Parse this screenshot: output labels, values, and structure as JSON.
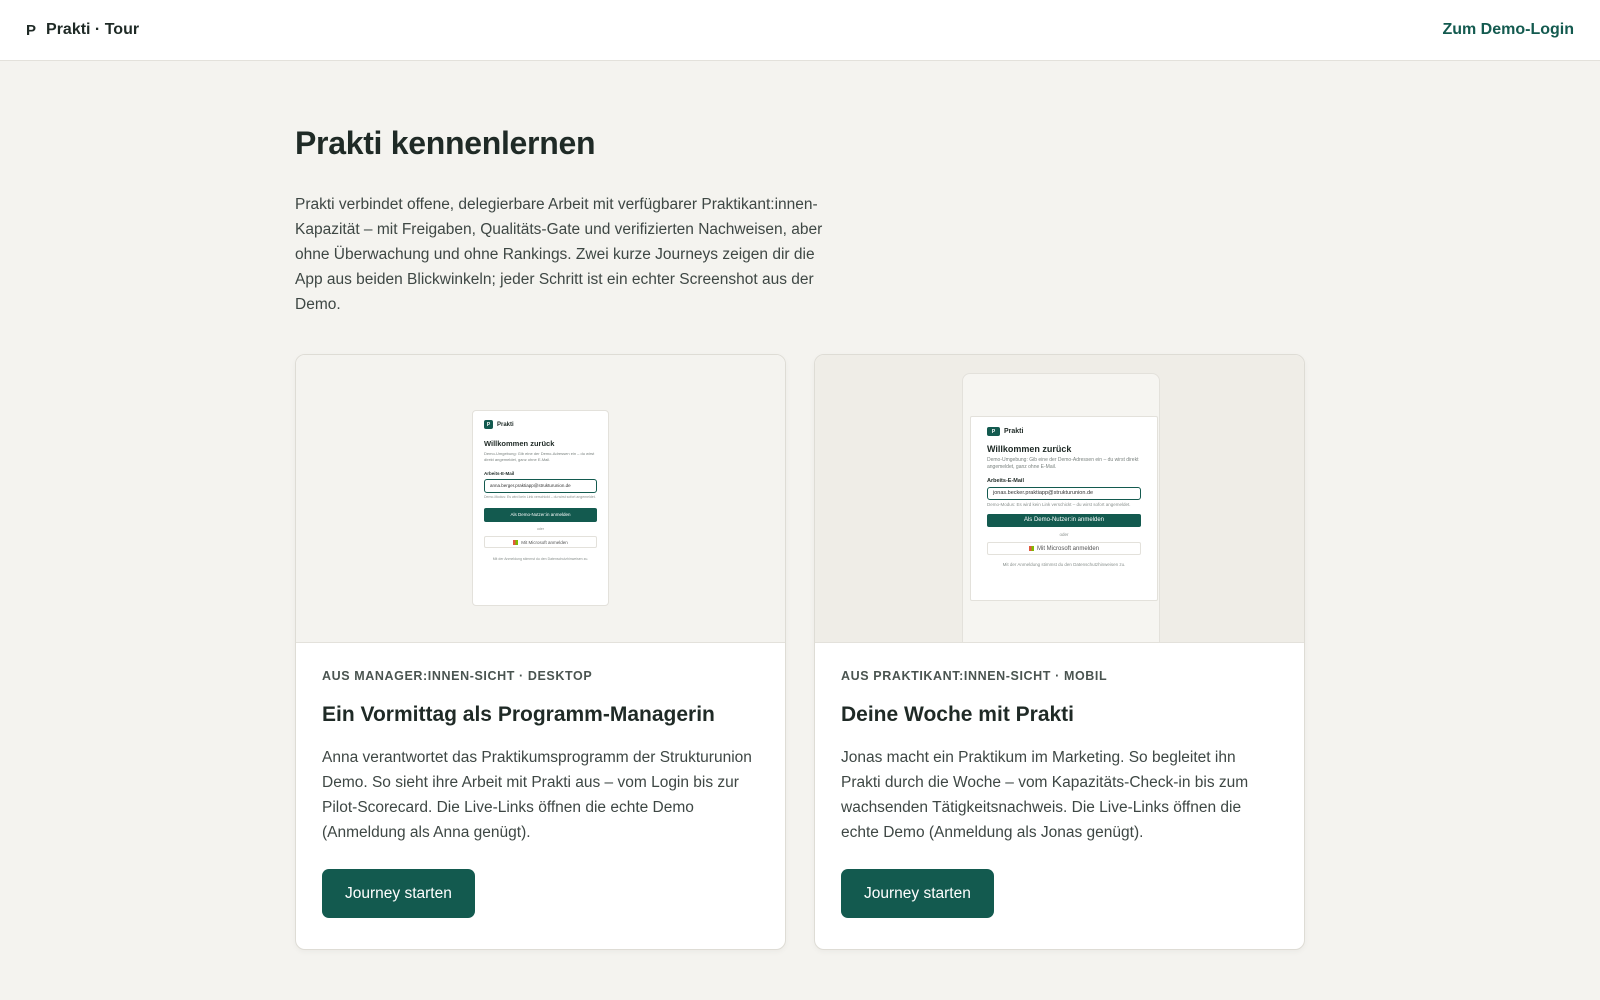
{
  "header": {
    "brand_mark": "P",
    "brand_name": "Prakti · Tour",
    "demo_link": "Zum Demo-Login"
  },
  "main": {
    "title": "Prakti kennenlernen",
    "intro": "Prakti verbindet offene, delegierbare Arbeit mit verfügbarer Praktikant:innen-Kapazität – mit Freigaben, Qualitäts-Gate und verifizierten Nachweisen, aber ohne Überwachung und ohne Rankings. Zwei kurze Journeys zeigen dir die App aus beiden Blickwinkeln; jeder Schritt ist ein echter Screenshot aus der Demo."
  },
  "cards": [
    {
      "eyebrow": "AUS MANAGER:INNEN-SICHT · DESKTOP",
      "title": "Ein Vormittag als Programm-Managerin",
      "description": "Anna verantwortet das Praktikumsprogramm der Strukturunion Demo. So sieht ihre Arbeit mit Prakti aus – vom Login bis zur Pilot-Scorecard. Die Live-Links öffnen die echte Demo (Anmeldung als Anna genügt).",
      "button": "Journey starten",
      "preview": {
        "brand": "Prakti",
        "logo": "P",
        "title": "Willkommen zurück",
        "subtitle": "Demo-Umgebung: Gib eine der Demo-Adressen ein – du wirst direkt angemeldet, ganz ohne E-Mail.",
        "label": "Arbeits-E-Mail",
        "email": "anna.berger.praktiapp@strukturunion.de",
        "hint": "Demo-Modus: Es wird kein Link verschickt – du wirst sofort angemeldet.",
        "submit": "Als Demo-Nutzer:in anmelden",
        "or": "oder",
        "microsoft": "Mit Microsoft anmelden",
        "footer": "Mit der Anmeldung stimmst du den Datenschutzhinweisen zu."
      }
    },
    {
      "eyebrow": "AUS PRAKTIKANT:INNEN-SICHT · MOBIL",
      "title": "Deine Woche mit Prakti",
      "description": "Jonas macht ein Praktikum im Marketing. So begleitet ihn Prakti durch die Woche – vom Kapazitäts-Check-in bis zum wachsenden Tätigkeitsnachweis. Die Live-Links öffnen die echte Demo (Anmeldung als Jonas genügt).",
      "button": "Journey starten",
      "preview": {
        "brand": "Prakti",
        "logo": "P",
        "title": "Willkommen zurück",
        "subtitle": "Demo-Umgebung: Gib eine der Demo-Adressen ein – du wirst direkt angemeldet, ganz ohne E-Mail.",
        "label": "Arbeits-E-Mail",
        "email": "jonas.becker.praktiapp@strukturunion.de",
        "hint": "Demo-Modus: Es wird kein Link verschickt – du wirst sofort angemeldet.",
        "submit": "Als Demo-Nutzer:in anmelden",
        "or": "oder",
        "microsoft": "Mit Microsoft anmelden",
        "footer": "Mit der Anmeldung stimmst du den Datenschutzhinweisen zu."
      }
    }
  ],
  "colors": {
    "accent": "#135a4f",
    "background": "#f4f3ef",
    "text": "#1f2a26"
  }
}
